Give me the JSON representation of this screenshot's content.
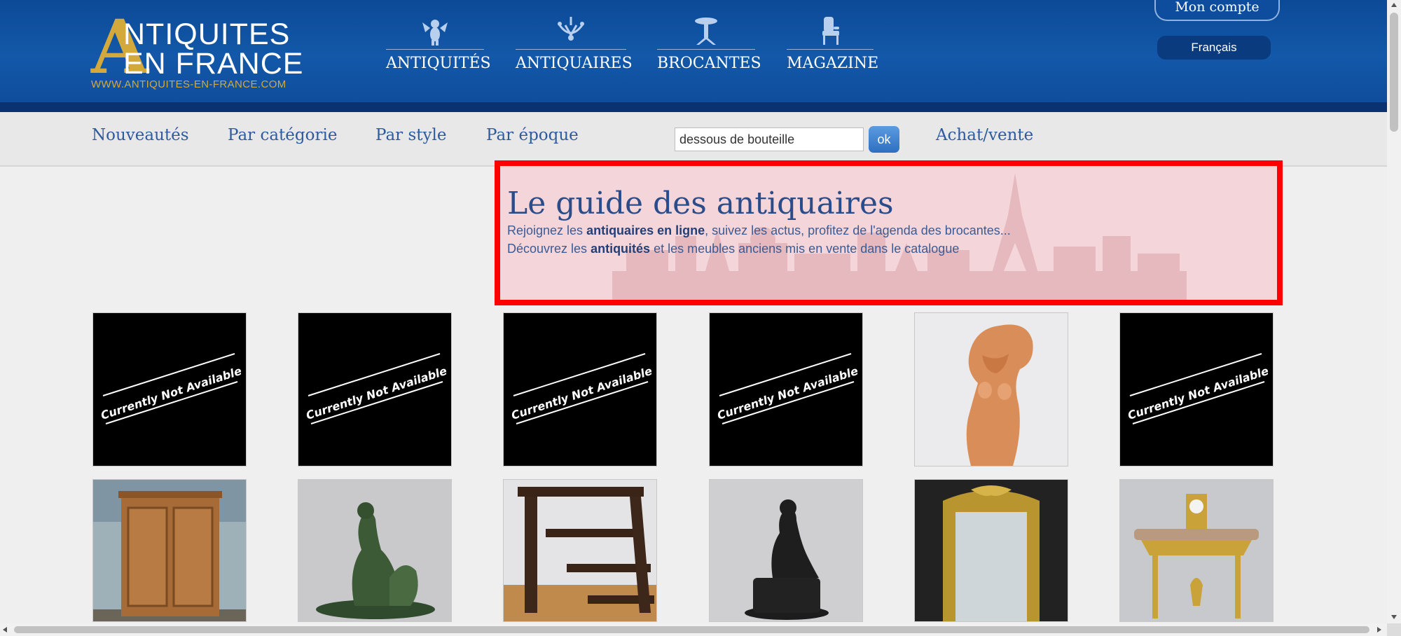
{
  "logo": {
    "big_letter": "A",
    "line1": "NTIQUITES",
    "line2": "EN FRANCE",
    "url": "WWW.ANTIQUITES-EN-FRANCE.COM"
  },
  "main_nav": [
    {
      "label": "ANTIQUITÉS",
      "icon": "cherub-icon"
    },
    {
      "label": "ANTIQUAIRES",
      "icon": "chandelier-icon"
    },
    {
      "label": "BROCANTES",
      "icon": "pedestal-table-icon"
    },
    {
      "label": "MAGAZINE",
      "icon": "armchair-icon"
    }
  ],
  "account": {
    "label": "Mon compte"
  },
  "language": {
    "label": "Français"
  },
  "sub_nav": {
    "items": [
      "Nouveautés",
      "Par catégorie",
      "Par style",
      "Par époque"
    ],
    "buy_sell": "Achat/vente"
  },
  "search": {
    "value": "dessous de bouteille",
    "button": "ok"
  },
  "banner": {
    "title": "Le guide des antiquaires",
    "line1_pre": "Rejoignez les ",
    "line1_bold": "antiquaires en ligne",
    "line1_post": ", suivez les actus, profitez de l'agenda des brocantes...",
    "line2_pre": "Découvrez les ",
    "line2_bold": "antiquités",
    "line2_post": " et les meubles anciens mis en vente dans le catalogue"
  },
  "products_row1": [
    {
      "status": "Currently Not Available"
    },
    {
      "status": "Currently Not Available"
    },
    {
      "status": "Currently Not Available"
    },
    {
      "status": "Currently Not Available"
    },
    {
      "status": "",
      "image": "terracotta-sculpture"
    },
    {
      "status": "Currently Not Available"
    }
  ],
  "products_row2": [
    {
      "image": "wooden-corner-cabinet"
    },
    {
      "image": "bronze-faun-sculpture"
    },
    {
      "image": "library-step-ladder"
    },
    {
      "image": "black-bronze-seated-figure"
    },
    {
      "image": "gilt-mirror"
    },
    {
      "image": "gilt-console-with-clock"
    }
  ],
  "colors": {
    "header_blue": "#1358a9",
    "gold": "#d4a93c",
    "link_blue": "#2d5b9e",
    "banner_border": "#ff0000"
  }
}
